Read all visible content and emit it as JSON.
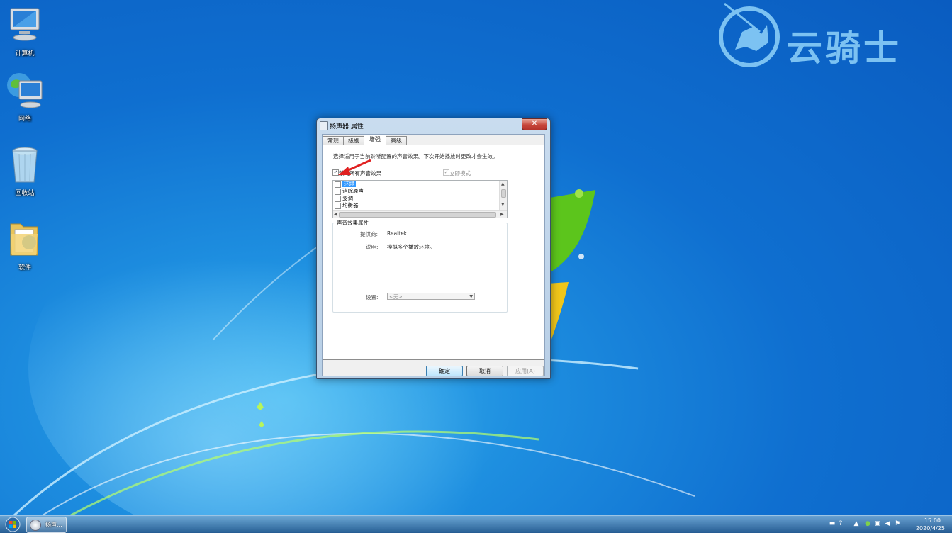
{
  "watermark": {
    "brand": "云骑士"
  },
  "desktop_icons": [
    {
      "label": "计算机",
      "icon": "computer-icon"
    },
    {
      "label": "网络",
      "icon": "network-icon"
    },
    {
      "label": "回收站",
      "icon": "recycle-bin-icon"
    },
    {
      "label": "软件",
      "icon": "folder-icon"
    }
  ],
  "dialog": {
    "title": "扬声器 属性",
    "close_symbol": "✕",
    "tabs": [
      {
        "label": "常规",
        "active": false
      },
      {
        "label": "级别",
        "active": false
      },
      {
        "label": "增强",
        "active": true
      },
      {
        "label": "高级",
        "active": false
      }
    ],
    "description": "选择适用于当前聆听配置的声音效果。下次开始播放时更改才会生效。",
    "disable_all_effects": {
      "label": "禁用所有声音效果",
      "checked": true,
      "mark": "✓"
    },
    "immediate_mode": {
      "label": "立即模式",
      "checked": true,
      "mark": "✓"
    },
    "effects_list": [
      {
        "label": "环境",
        "checked": false,
        "selected": true
      },
      {
        "label": "消除原声",
        "checked": false,
        "selected": false
      },
      {
        "label": "变调",
        "checked": false,
        "selected": false
      },
      {
        "label": "均衡器",
        "checked": false,
        "selected": false
      }
    ],
    "properties_group": {
      "title": "声音效果属性",
      "provider_label": "提供商:",
      "provider_value": "Realtek",
      "description_label": "说明:",
      "description_value": "模拟多个播放环境。",
      "settings_label": "设置:",
      "settings_value": "<无>"
    },
    "buttons": {
      "ok": "确定",
      "cancel": "取消",
      "apply": "应用(A)"
    }
  },
  "taskbar": {
    "task_label": "扬声...",
    "clock_time": "15:00",
    "clock_date": "2020/4/25"
  },
  "colors": {
    "desktop_blue": "#0f6fd0",
    "selection_blue": "#3399ff",
    "annotation_red": "#e02020",
    "watermark_blue": "#7cc2f2"
  }
}
